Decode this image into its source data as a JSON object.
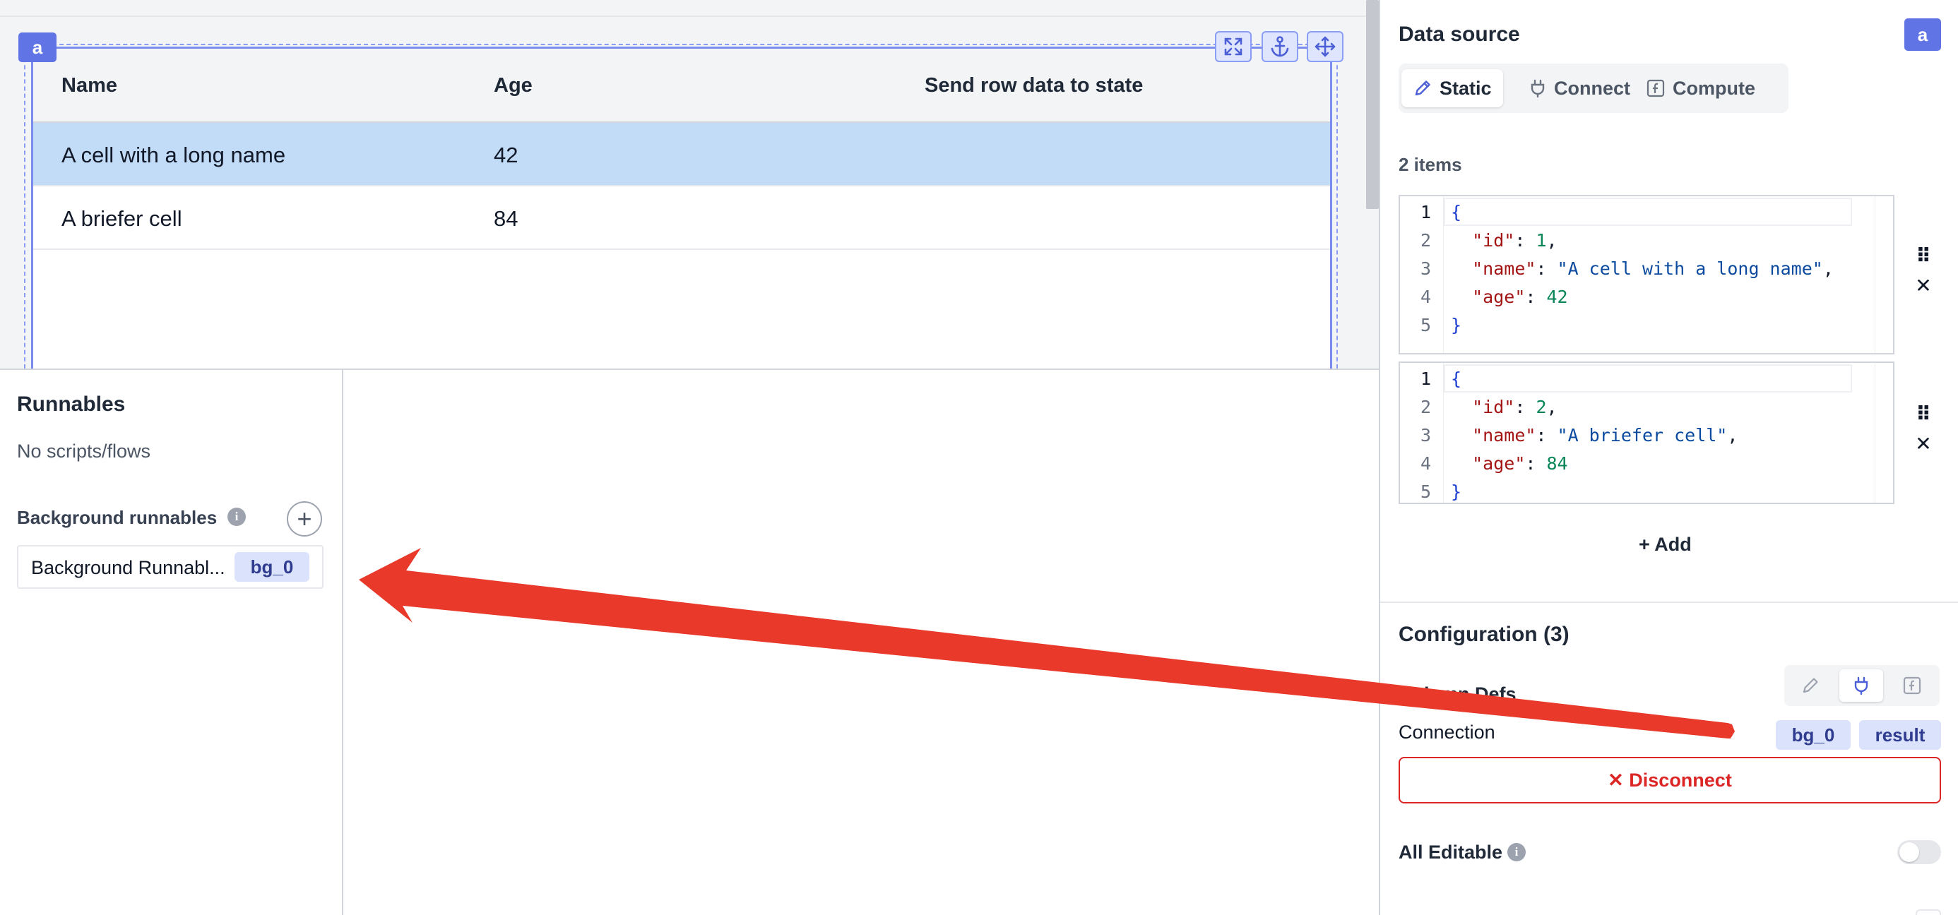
{
  "canvas": {
    "component_id": "a",
    "table": {
      "columns": [
        "Name",
        "Age",
        "Send row data to state"
      ],
      "rows": [
        {
          "name": "A cell with a long name",
          "age": "42",
          "selected": true
        },
        {
          "name": "A briefer cell",
          "age": "84",
          "selected": false
        }
      ]
    },
    "tools": [
      "expand-icon",
      "anchor-icon",
      "move-icon"
    ]
  },
  "runnables": {
    "title": "Runnables",
    "empty_text": "No scripts/flows",
    "background_title": "Background runnables",
    "items": [
      {
        "label": "Background Runnabl...",
        "id": "bg_0"
      }
    ]
  },
  "data_source": {
    "title": "Data source",
    "component_id": "a",
    "tabs": [
      {
        "label": "Static",
        "icon": "pencil-icon",
        "active": true
      },
      {
        "label": "Connect",
        "icon": "plug-icon",
        "active": false
      },
      {
        "label": "Compute",
        "icon": "function-icon",
        "active": false
      }
    ],
    "items_count": "2 items",
    "items": [
      {
        "id": "1",
        "name": "\"A cell with a long name\"",
        "age": "42"
      },
      {
        "id": "2",
        "name": "\"A briefer cell\"",
        "age": "84"
      }
    ],
    "add_label": "+ Add"
  },
  "configuration": {
    "title": "Configuration (3)",
    "column_defs_label": "Column Defs",
    "connection_label": "Connection",
    "connection_chips": [
      "bg_0",
      "result"
    ],
    "disconnect_label": "✕ Disconnect",
    "all_editable_label": "All Editable",
    "all_editable_on": false
  },
  "colors": {
    "accent": "#6174e6",
    "selected_row": "#c2dbf6",
    "danger": "#dc2626",
    "annotation_arrow": "#e8392a"
  }
}
